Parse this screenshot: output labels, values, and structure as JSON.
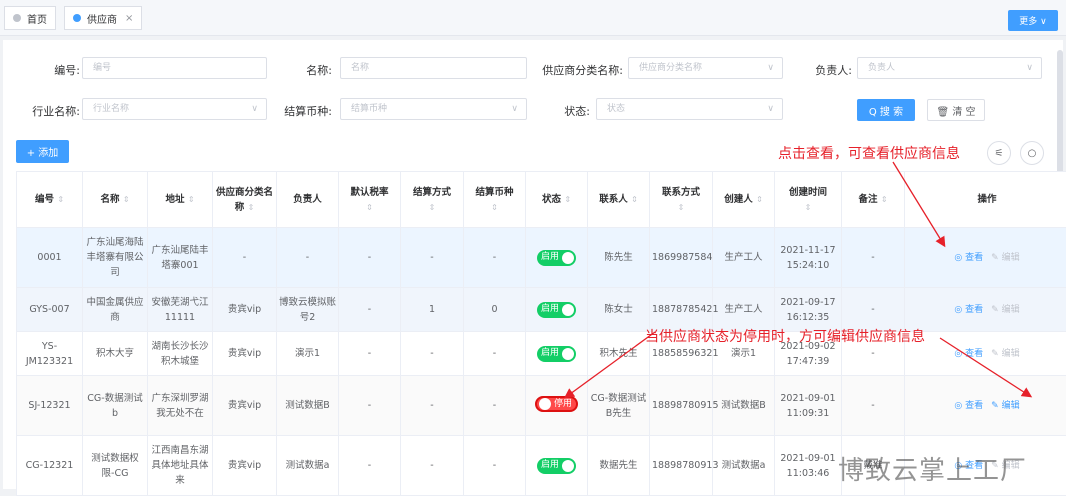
{
  "tabs": [
    {
      "label": "首页",
      "active": false
    },
    {
      "label": "供应商",
      "active": true,
      "close": "×"
    }
  ],
  "more_label": "更多 ∨",
  "filters": {
    "code": {
      "label": "编号:",
      "placeholder": "编号"
    },
    "name": {
      "label": "名称:",
      "placeholder": "名称"
    },
    "category": {
      "label": "供应商分类名称:",
      "placeholder": "供应商分类名称"
    },
    "owner": {
      "label": "负责人:",
      "placeholder": "负责人"
    },
    "industry": {
      "label": "行业名称:",
      "placeholder": "行业名称"
    },
    "currency": {
      "label": "结算币种:",
      "placeholder": "结算币种"
    },
    "status": {
      "label": "状态:",
      "placeholder": "状态"
    }
  },
  "buttons": {
    "search": "Q 搜 索",
    "clear": "🗑 清 空",
    "add": "+ 添加"
  },
  "columns": [
    "编号",
    "名称",
    "地址",
    "供应商分类名称",
    "负责人",
    "默认税率",
    "结算方式",
    "结算币种",
    "状态",
    "联系人",
    "联系方式",
    "创建人",
    "创建时间",
    "备注",
    "操作"
  ],
  "rows": [
    {
      "code": "0001",
      "name": "广东汕尾海陆丰塔寨有限公司",
      "addr": "广东汕尾陆丰塔寨001",
      "cat": "-",
      "owner": "-",
      "tax": "-",
      "settle": "-",
      "cur": "-",
      "status": "启用",
      "contact": "陈先生",
      "phone": "1869987584",
      "creator": "生产工人",
      "created": "2021-11-17 15:24:10",
      "remark": "-"
    },
    {
      "code": "GYS-007",
      "name": "中国金属供应商",
      "addr": "安徽芜湖弋江11111",
      "cat": "贵宾vip",
      "owner": "博致云模拟账号2",
      "tax": "-",
      "settle": "1",
      "cur": "0",
      "status": "启用",
      "contact": "陈女士",
      "phone": "18878785421",
      "creator": "生产工人",
      "created": "2021-09-17 16:12:35",
      "remark": "-"
    },
    {
      "code": "YS-JM123321",
      "name": "积木大亨",
      "addr": "湖南长沙长沙积木城堡",
      "cat": "贵宾vip",
      "owner": "演示1",
      "tax": "-",
      "settle": "-",
      "cur": "-",
      "status": "启用",
      "contact": "积木先生",
      "phone": "18858596321",
      "creator": "演示1",
      "created": "2021-09-02 17:47:39",
      "remark": "-"
    },
    {
      "code": "SJ-12321",
      "name": "CG-数据测试b",
      "addr": "广东深圳罗湖我无处不在",
      "cat": "贵宾vip",
      "owner": "测试数据B",
      "tax": "-",
      "settle": "-",
      "cur": "-",
      "status": "停用",
      "contact": "CG-数据测试B先生",
      "phone": "18898780915",
      "creator": "测试数据B",
      "created": "2021-09-01 11:09:31",
      "remark": "-"
    },
    {
      "code": "CG-12321",
      "name": "测试数据权限-CG",
      "addr": "江西南昌东湖具体地址具体来",
      "cat": "贵宾vip",
      "owner": "测试数据a",
      "tax": "-",
      "settle": "-",
      "cur": "-",
      "status": "启用",
      "contact": "数据先生",
      "phone": "18898780913",
      "creator": "测试数据a",
      "created": "2021-09-01 11:03:46",
      "remark": "戴准"
    }
  ],
  "ops": {
    "view": "查看",
    "edit": "编辑"
  },
  "annotations": {
    "a1": "点击查看，可查看供应商信息",
    "a2": "当供应商状态为停用时，方可编辑供应商信息"
  },
  "watermark": "博致云掌上工厂",
  "colors": {
    "primary": "#409eff",
    "success": "#13ce66",
    "danger": "#ff4949",
    "annotation": "#e6212a"
  }
}
